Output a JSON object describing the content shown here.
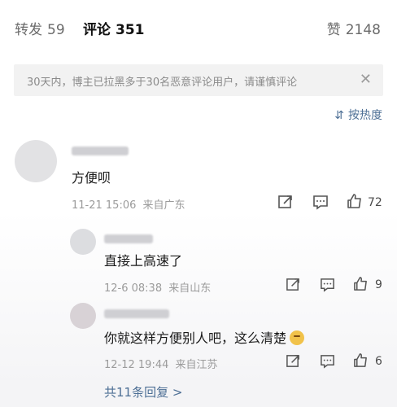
{
  "tabs": {
    "reposts": {
      "label": "转发",
      "count": "59"
    },
    "comments": {
      "label": "评论",
      "count": "351"
    },
    "likes": {
      "label": "赞",
      "count": "2148"
    }
  },
  "notice": {
    "text": "30天内，博主已拉黑多于30名恶意评论用户，请谨慎评论"
  },
  "sort": {
    "label": "按热度"
  },
  "comment": {
    "text": "方便呗",
    "time": "11-21 15:06",
    "location": "来自广东",
    "likes": "72"
  },
  "replies": [
    {
      "text": "直接上高速了",
      "time": "12-6 08:38",
      "location": "来自山东",
      "likes": "9"
    },
    {
      "text": "你就这样方便别人吧，这么清楚",
      "time": "12-12 19:44",
      "location": "来自江苏",
      "likes": "6"
    }
  ],
  "more_replies": {
    "label": "共11条回复 >"
  },
  "colors": {
    "link": "#4d6f95",
    "muted": "#9b9b9b"
  }
}
